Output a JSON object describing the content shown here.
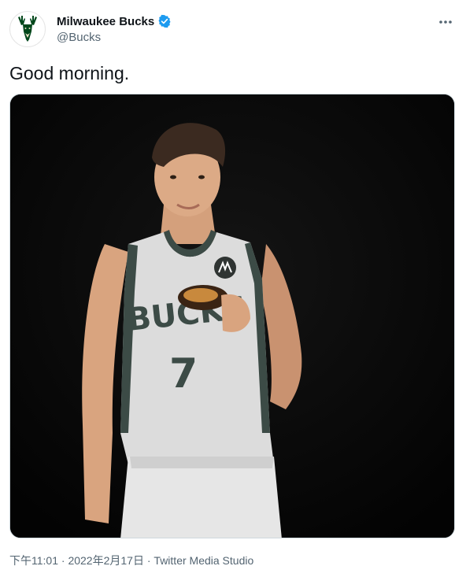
{
  "tweet": {
    "display_name": "Milwaukee Bucks",
    "handle": "@Bucks",
    "text": "Good morning.",
    "media": {
      "jersey_text": "BUCKS",
      "jersey_number": "7"
    },
    "time": "下午11:01",
    "separator": " · ",
    "date": "2022年2月17日",
    "source": "Twitter Media Studio"
  },
  "icons": {
    "avatar": "bucks-deer-logo-icon",
    "verified": "verified-badge-icon",
    "more": "more-options-icon"
  },
  "colors": {
    "bucks_green": "#00471b",
    "bucks_cream": "#eee1c6",
    "verified_blue": "#1d9bf0",
    "secondary_text": "#536471"
  }
}
